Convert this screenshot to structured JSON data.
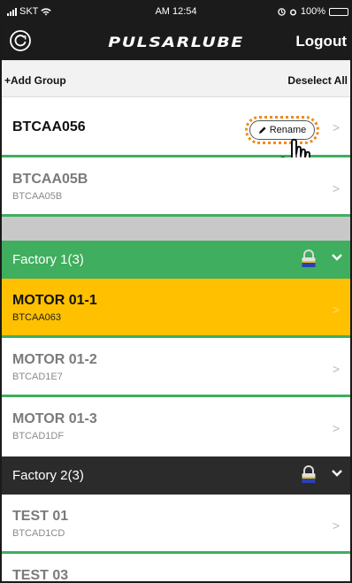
{
  "status_bar": {
    "carrier": "SKT",
    "time": "AM 12:54",
    "battery": "100%"
  },
  "header": {
    "logo": "PULSARLUBE",
    "logout_label": "Logout"
  },
  "toolbar": {
    "add_group_label": "+Add Group",
    "deselect_all_label": "Deselect All"
  },
  "ungrouped": [
    {
      "name": "BTCAA056",
      "rename_label": "Rename",
      "selected": true
    },
    {
      "name": "BTCAA05B",
      "id": "BTCAA05B"
    }
  ],
  "groups": [
    {
      "name": "Factory 1(3)",
      "color": "#3fae5e",
      "devices": [
        {
          "name": "MOTOR 01-1",
          "id": "BTCAA063",
          "highlight": "#ffc000"
        },
        {
          "name": "MOTOR 01-2",
          "id": "BTCAD1E7"
        },
        {
          "name": "MOTOR 01-3",
          "id": "BTCAD1DF"
        }
      ]
    },
    {
      "name": "Factory 2(3)",
      "color": "#2b2b2b",
      "devices": [
        {
          "name": "TEST 01",
          "id": "BTCAD1CD"
        },
        {
          "name": "TEST 03"
        }
      ]
    }
  ],
  "icons": {
    "refresh": "refresh-icon",
    "pencil": "pencil-icon",
    "chevron": "chevron-right-icon",
    "lock": "lock-icon",
    "caret": "chevron-down-icon",
    "hand": "hand-pointer-icon"
  }
}
